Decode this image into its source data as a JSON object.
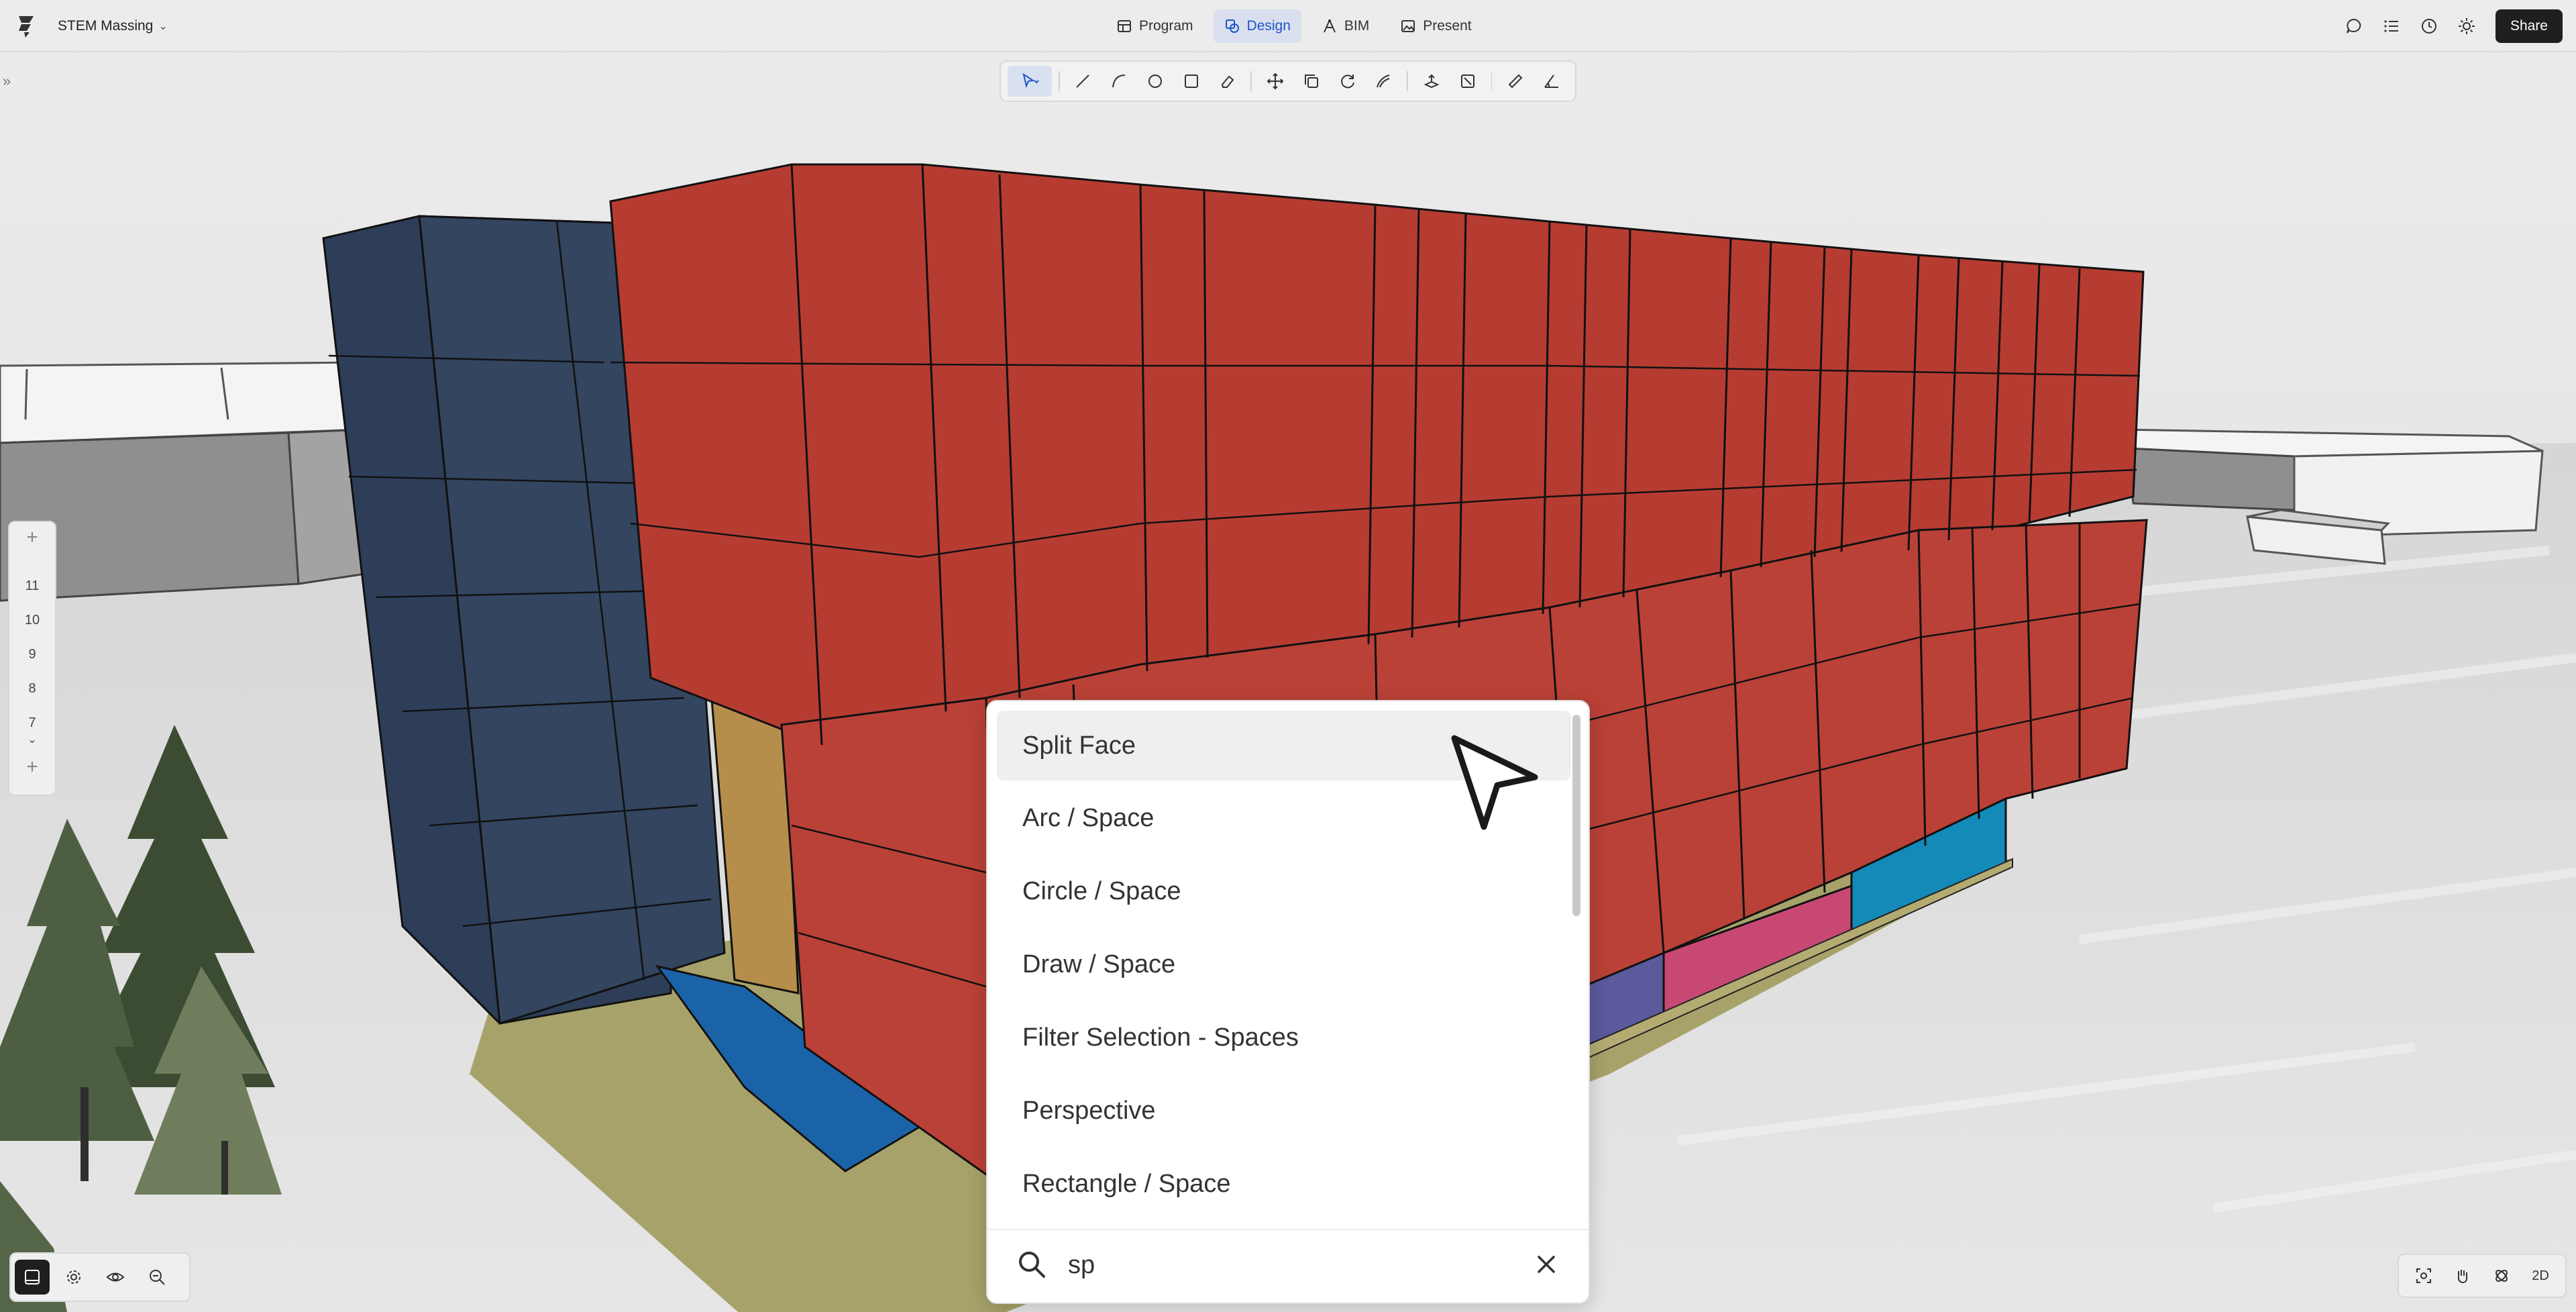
{
  "app": {
    "project_name": "STEM Massing"
  },
  "modes": [
    {
      "label": "Program",
      "icon": "table-icon"
    },
    {
      "label": "Design",
      "icon": "shapes-icon",
      "active": true
    },
    {
      "label": "BIM",
      "icon": "compass-icon"
    },
    {
      "label": "Present",
      "icon": "image-icon"
    }
  ],
  "header": {
    "share_label": "Share"
  },
  "levels": [
    "11",
    "10",
    "9",
    "8",
    "7"
  ],
  "view": {
    "mode_2d_label": "2D"
  },
  "command_palette": {
    "items": [
      "Split Face",
      "Arc / Space",
      "Circle / Space",
      "Draw / Space",
      "Filter Selection - Spaces",
      "Perspective",
      "Rectangle / Space"
    ],
    "highlighted_index": 0,
    "search_value": "sp"
  },
  "colors": {
    "red_mass": "#b63c32",
    "navy_mass": "#2e3e58",
    "accent": "#1f56c9"
  }
}
